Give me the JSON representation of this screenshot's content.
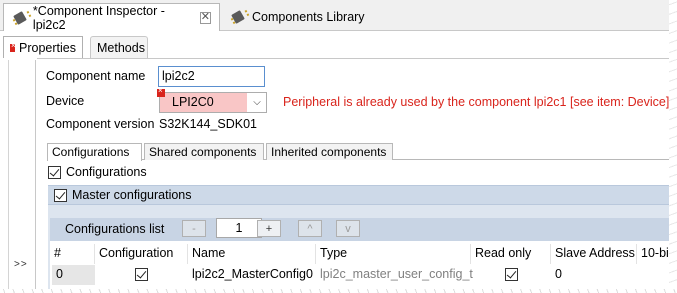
{
  "editor_tabs": [
    {
      "label": "*Component Inspector - lpi2c2",
      "icon": "chip-icon",
      "active": true
    },
    {
      "label": "Components Library",
      "icon": "chip-icon",
      "active": false
    }
  ],
  "view_tabs": [
    {
      "label": "Properties",
      "icon": "error-icon",
      "active": true
    },
    {
      "label": "Methods",
      "active": false
    }
  ],
  "rail": {
    "toggle_label": ">>"
  },
  "form": {
    "component_name_label": "Component name",
    "component_name_value": "lpi2c2",
    "device_label": "Device",
    "device_value": "LPI2C0",
    "device_error": "Peripheral is already used by the component lpi2c1 [see item: Device]",
    "version_label": "Component version",
    "version_value": "S32K144_SDK01"
  },
  "sub_tabs": [
    "Configurations",
    "Shared components",
    "Inherited components"
  ],
  "configurations": {
    "checkbox_label": "Configurations",
    "master_label": "Master configurations",
    "list_label": "Configurations list",
    "remove_button": "-",
    "count": "1",
    "add_button": "+",
    "up_button": "^",
    "down_button": "v"
  },
  "table": {
    "columns": [
      "#",
      "Configuration",
      "Name",
      "Type",
      "Read only",
      "Slave Address",
      "10-bi"
    ],
    "rows": [
      {
        "index": "0",
        "configuration": true,
        "name": "lpi2c2_MasterConfig0",
        "type": "lpi2c_master_user_config_t",
        "read_only": true,
        "slave_address": "0"
      }
    ]
  },
  "colors": {
    "error": "#d9241c",
    "group_header": "#cdd9e8",
    "device_bg": "#f9c6c6"
  }
}
